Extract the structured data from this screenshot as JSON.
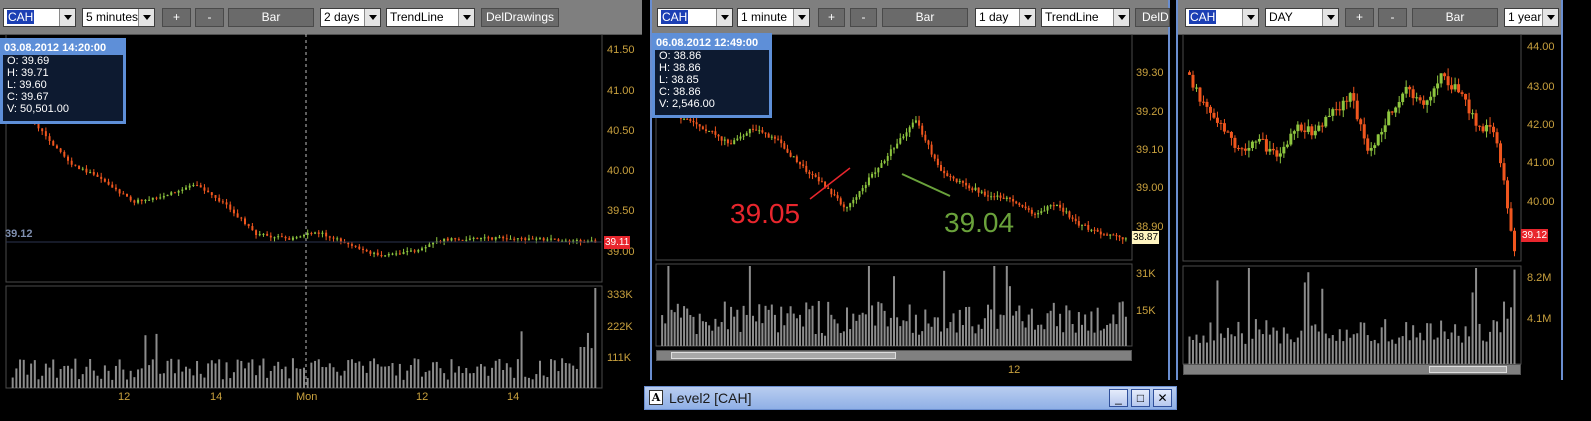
{
  "colors": {
    "up": "#8ec63f",
    "down": "#f0561e",
    "axis": "#c9a13e",
    "grid": "#4a4a4a",
    "volume": "#8c8c8c",
    "annotRed": "#e8262d",
    "annotGreen": "#6aa23b"
  },
  "panels": [
    {
      "symbol": "CAH",
      "interval": "5 minutes",
      "chart_type": "Bar",
      "range": "2 days",
      "drawing_tool": "TrendLine",
      "del_label": "DelDrawings",
      "plus": "+",
      "minus": "-",
      "info": {
        "timestamp": "03.08.2012 14:20:00",
        "open": "O: 39.69",
        "high": "H: 39.71",
        "low": "L: 39.60",
        "close": "C: 39.67",
        "volume": "V: 50,501.00"
      },
      "price_axis": [
        "41.50",
        "41.00",
        "40.50",
        "40.00",
        "39.50",
        "39.00"
      ],
      "volume_axis": [
        "333K",
        "222K",
        "111K"
      ],
      "x_axis": [
        "12",
        "14",
        "Mon",
        "12",
        "14"
      ],
      "last_price": "39.11",
      "crosshair_price": "39.12"
    },
    {
      "symbol": "CAH",
      "interval": "1 minute",
      "chart_type": "Bar",
      "range": "1 day",
      "drawing_tool": "TrendLine",
      "del_label": "DelD",
      "plus": "+",
      "minus": "-",
      "info": {
        "timestamp": "06.08.2012 12:49:00",
        "open": "O: 38.86",
        "high": "H: 38.86",
        "low": "L: 38.85",
        "close": "C: 38.86",
        "volume": "V: 2,546.00"
      },
      "price_axis": [
        "39.30",
        "39.20",
        "39.10",
        "39.00",
        "38.90"
      ],
      "volume_axis": [
        "31K",
        "15K"
      ],
      "x_axis": [
        "12"
      ],
      "last_price": "38.87",
      "annotations": [
        "39.05",
        "39.04"
      ]
    },
    {
      "symbol": "CAH",
      "interval": "DAY",
      "chart_type": "Bar",
      "range": "1 year",
      "plus": "+",
      "minus": "-",
      "price_axis": [
        "44.00",
        "43.00",
        "42.00",
        "41.00",
        "40.00"
      ],
      "volume_axis": [
        "8.2M",
        "4.1M"
      ],
      "last_price": "39.12"
    }
  ],
  "level2_window": {
    "title": "Level2 [CAH]",
    "icon": "A",
    "buttons": [
      "_",
      "□",
      "✕"
    ]
  }
}
